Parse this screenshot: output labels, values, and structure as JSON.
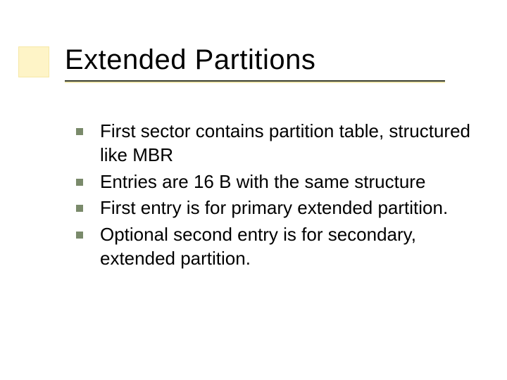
{
  "slide": {
    "title": "Extended Partitions",
    "bullets": [
      "First sector contains partition table, structured like MBR",
      "Entries are 16 B with the same structure",
      "First entry is for primary extended partition.",
      "Optional second entry is for secondary, extended partition."
    ]
  },
  "colors": {
    "accent_square_bg": "#fef4c7",
    "bullet_color": "#7a8a6b",
    "underline_dark": "#3b3f2f",
    "underline_light": "#f2e9b4"
  }
}
